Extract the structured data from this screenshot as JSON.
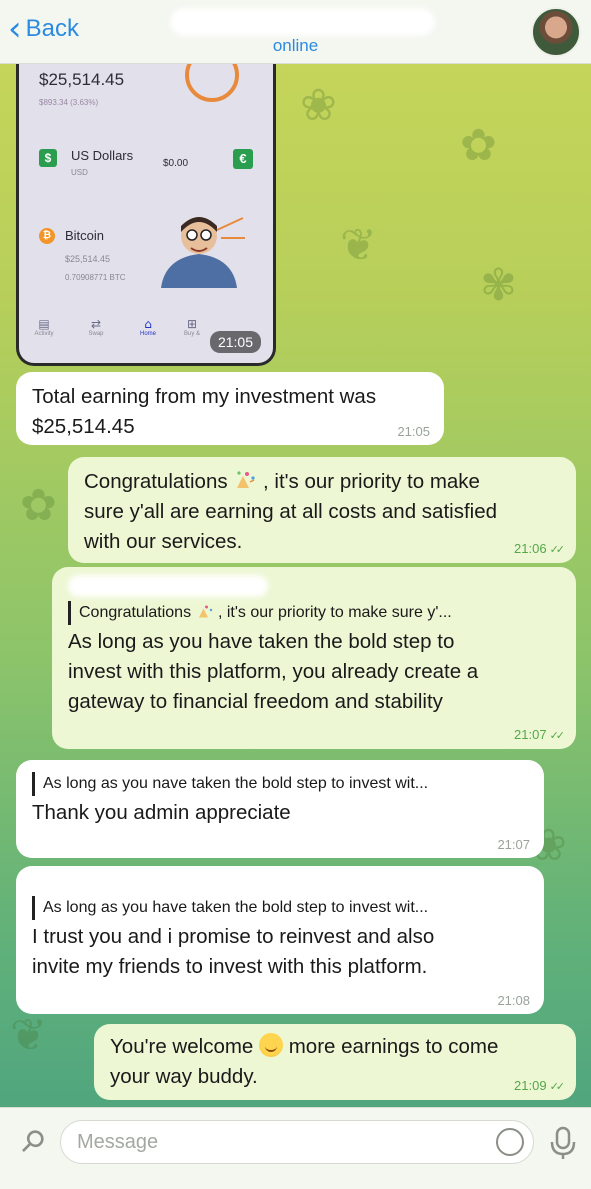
{
  "header": {
    "back_label": "Back",
    "status": "online"
  },
  "photo_message": {
    "balance": "$25,514.45",
    "change": "$893.34 (3.63%)",
    "currency_name": "US Dollars",
    "currency_code": "USD",
    "currency_value": "$0.00",
    "crypto_name": "Bitcoin",
    "crypto_value": "$25,514.45",
    "crypto_amount": "0.70908771 BTC",
    "nav": [
      "Activity",
      "Swap",
      "Home",
      "Buy &"
    ],
    "time": "21:05"
  },
  "messages": [
    {
      "dir": "in",
      "text1": "Total earning from my investment was",
      "text2": "$25,514.45",
      "time": "21:05"
    },
    {
      "dir": "out",
      "text1": "Congratulations",
      "text1b": ", it's our priority to make",
      "text2": "sure y'all are earning at all costs and satisfied",
      "text3": "with our services.",
      "time": "21:06"
    },
    {
      "dir": "out",
      "reply": "Congratulations",
      "reply_b": ", it's our priority to make sure y'...",
      "text1": "As long as you have taken the bold step to",
      "text2": "invest with this platform, you already create a",
      "text3": "gateway to financial freedom and stability",
      "time": "21:07"
    },
    {
      "dir": "in",
      "reply": "As long as you nave taken the bold step to invest wit...",
      "text1": "Thank you admin appreciate",
      "time": "21:07"
    },
    {
      "dir": "in",
      "reply": "As long as you have taken the bold step to invest wit...",
      "text1": "I trust you and i promise to reinvest and also",
      "text2": "invite my friends to invest with this platform.",
      "time": "21:08"
    },
    {
      "dir": "out",
      "text1": "You're welcome",
      "text1b": "more earnings to come",
      "text2": "your way buddy.",
      "time": "21:09"
    }
  ],
  "input": {
    "placeholder": "Message"
  },
  "colors": {
    "accent": "#2b8be0",
    "outgoing_bubble": "#edf7d4",
    "incoming_bubble": "#ffffff",
    "read_ticks": "#55a84a"
  },
  "icons": [
    "chevron-left-icon",
    "paperclip-icon",
    "sticker-icon",
    "microphone-icon",
    "double-check-icon"
  ]
}
